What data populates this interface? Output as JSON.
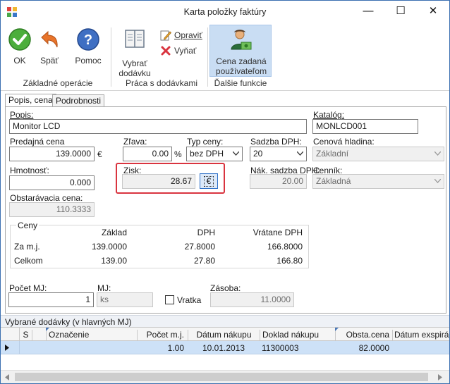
{
  "window": {
    "title": "Karta položky faktúry",
    "minimize": "—",
    "maximize": "☐",
    "close": "✕"
  },
  "ribbon": {
    "ok_label": "OK",
    "back_label": "Späť",
    "help_label": "Pomoc",
    "group_basic": "Základné operácie",
    "choose_delivery_line1": "Vybrať",
    "choose_delivery_line2": "dodávku",
    "edit_label": "Opraviť",
    "remove_label": "Vyňať",
    "group_delivery": "Práca s dodávkami",
    "user_price_line1": "Cena zadaná",
    "user_price_line2": "používateľom",
    "group_other": "Ďalšie funkcie"
  },
  "tabs": [
    {
      "label": "Popis, cena"
    },
    {
      "label": "Podrobnosti"
    }
  ],
  "form": {
    "popis_label": "Popis:",
    "popis_value": "Monitor LCD",
    "katalog_label": "Katalóg:",
    "katalog_value": "MONLCD001",
    "predajna_label": "Predajná cena",
    "predajna_value": "139.0000",
    "currency": "€",
    "zlava_label": "Zľava:",
    "zlava_value": "0.00",
    "percent": "%",
    "typ_label": "Typ ceny:",
    "typ_value": "bez DPH",
    "sadzba_label": "Sadzba DPH:",
    "sadzba_value": "20",
    "hladina_label": "Cenová hladina:",
    "hladina_value": "Základní",
    "hmotnost_label": "Hmotnosť:",
    "hmotnost_value": "0.000",
    "zisk_label": "Zisk:",
    "zisk_value": "28.67",
    "zisk_currency": "€",
    "nak_sadzba_label": "Nák. sadzba DPH:",
    "nak_sadzba_value": "20.00",
    "cennik_label": "Cenník:",
    "cennik_value": "Základná",
    "obstaravacia_label": "Obstarávacia cena:",
    "obstaravacia_value": "110.3333"
  },
  "ceny": {
    "title": "Ceny",
    "headers": [
      "Základ",
      "DPH",
      "Vrátane DPH"
    ],
    "rows": [
      {
        "label": "Za m.j.",
        "zaklad": "139.0000",
        "dph": "27.8000",
        "vratane": "166.8000"
      },
      {
        "label": "Celkom",
        "zaklad": "139.00",
        "dph": "27.80",
        "vratane": "166.80"
      }
    ]
  },
  "bottom": {
    "pocet_label": "Počet MJ:",
    "pocet_value": "1",
    "mj_label": "MJ:",
    "mj_value": "ks",
    "vratka_label": "Vratka",
    "zasoba_label": "Zásoba:",
    "zasoba_value": "11.0000"
  },
  "deliveries": {
    "title": "Vybrané dodávky (v hlavných MJ)",
    "columns": [
      "S",
      "Označenie",
      "Počet m.j.",
      "Dátum nákupu",
      "Doklad nákupu",
      "Obsta.cena",
      "Dátum exspirácie"
    ],
    "rows": [
      {
        "s": "",
        "oznacenie": "",
        "pocet": "1.00",
        "datum": "10.01.2013",
        "doklad": "11300003",
        "obsta": "82.0000",
        "exspiracia": ""
      }
    ]
  },
  "colors": {
    "accent": "#3b6fb0",
    "highlight_red": "#d9343f",
    "row_selected": "#cde1f7",
    "ribbon_active": "#c9ddf3"
  }
}
